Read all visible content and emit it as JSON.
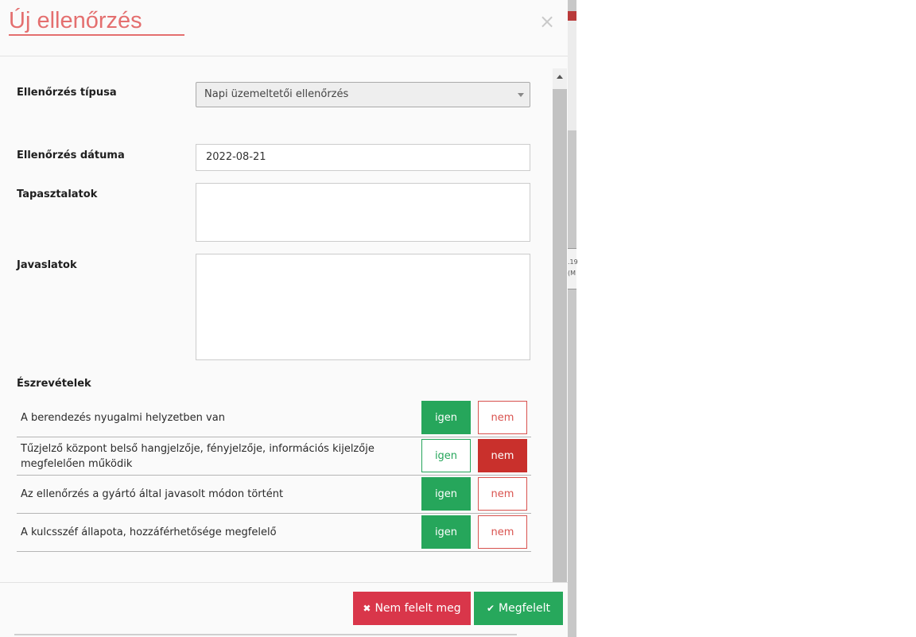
{
  "modal": {
    "title": "Új ellenőrzés",
    "close_glyph": "×"
  },
  "form": {
    "type_label": "Ellenőrzés típusa",
    "type_value": "Napi üzemeltetői ellenőrzés",
    "date_label": "Ellenőrzés dátuma",
    "date_value": "2022-08-21",
    "experiences_label": "Tapasztalatok",
    "experiences_value": "",
    "suggestions_label": "Javaslatok",
    "suggestions_value": ""
  },
  "observations": {
    "title": "Észrevételek",
    "yes_label": "igen",
    "no_label": "nem",
    "items": [
      {
        "text": "A berendezés nyugalmi helyzetben van",
        "selected": "igen"
      },
      {
        "text": "Tűzjelző központ belső hangjelzője, fényjelzője, információs kijelzője megfelelően működik",
        "selected": "nem"
      },
      {
        "text": "Az ellenőrzés a gyártó által javasolt módon történt",
        "selected": "igen"
      },
      {
        "text": "A kulcsszéf állapota, hozzáférhetősége megfelelő",
        "selected": "igen"
      }
    ]
  },
  "footer": {
    "fail_label": "Nem felelt meg",
    "fail_icon": "times-icon",
    "ok_label": "Megfelelt",
    "ok_icon": "check-icon"
  },
  "background": {
    "snippet_line1": ".19",
    "snippet_line2": "(M"
  },
  "colors": {
    "title": "#e46f6f",
    "yes_green": "#26a65b",
    "no_red": "#c9302c",
    "fail_button": "#d9364a",
    "ok_button": "#27a85c"
  }
}
